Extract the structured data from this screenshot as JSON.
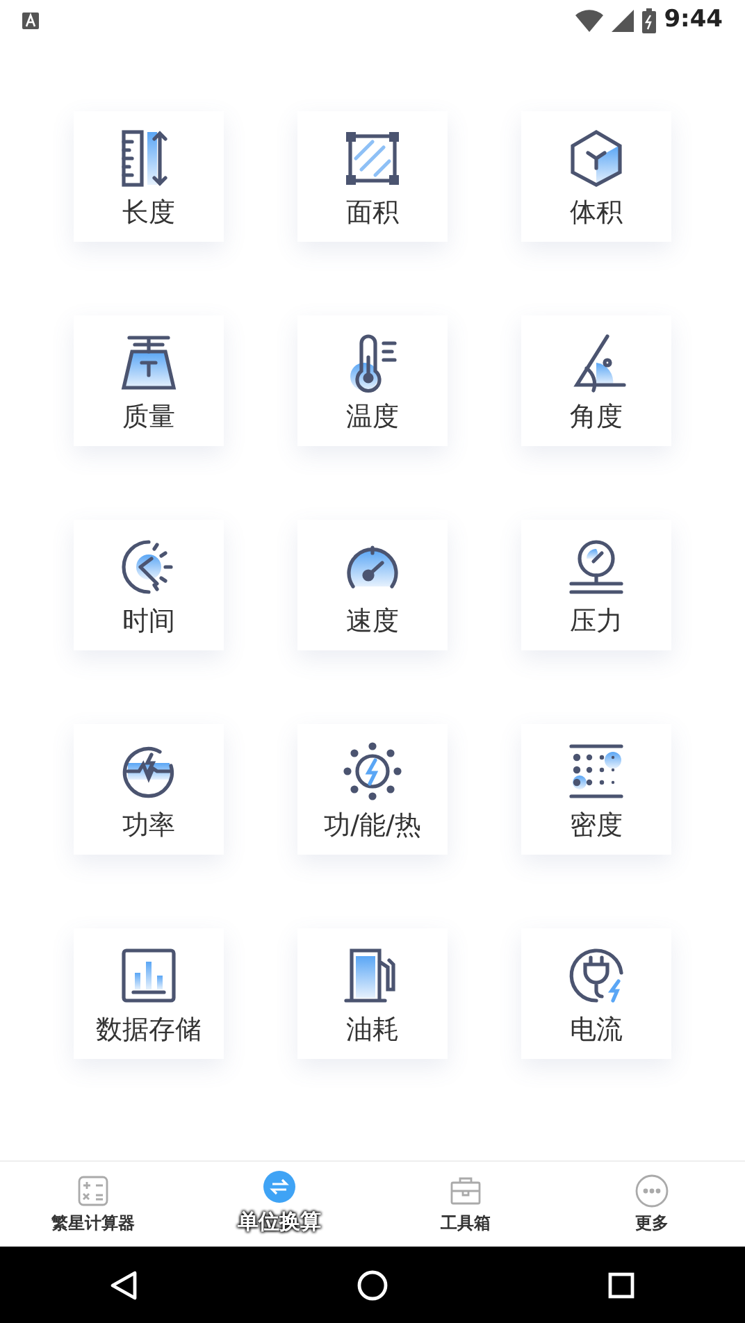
{
  "status_bar": {
    "time": "9:44"
  },
  "units": [
    {
      "label": "长度"
    },
    {
      "label": "面积"
    },
    {
      "label": "体积"
    },
    {
      "label": "质量"
    },
    {
      "label": "温度"
    },
    {
      "label": "角度"
    },
    {
      "label": "时间"
    },
    {
      "label": "速度"
    },
    {
      "label": "压力"
    },
    {
      "label": "功率"
    },
    {
      "label": "功/能/热"
    },
    {
      "label": "密度"
    },
    {
      "label": "数据存储"
    },
    {
      "label": "油耗"
    },
    {
      "label": "电流"
    }
  ],
  "tabs": [
    {
      "label": "繁星计算器",
      "selected": false
    },
    {
      "label": "单位换算",
      "selected": true
    },
    {
      "label": "工具箱",
      "selected": false
    },
    {
      "label": "更多",
      "selected": false
    }
  ]
}
